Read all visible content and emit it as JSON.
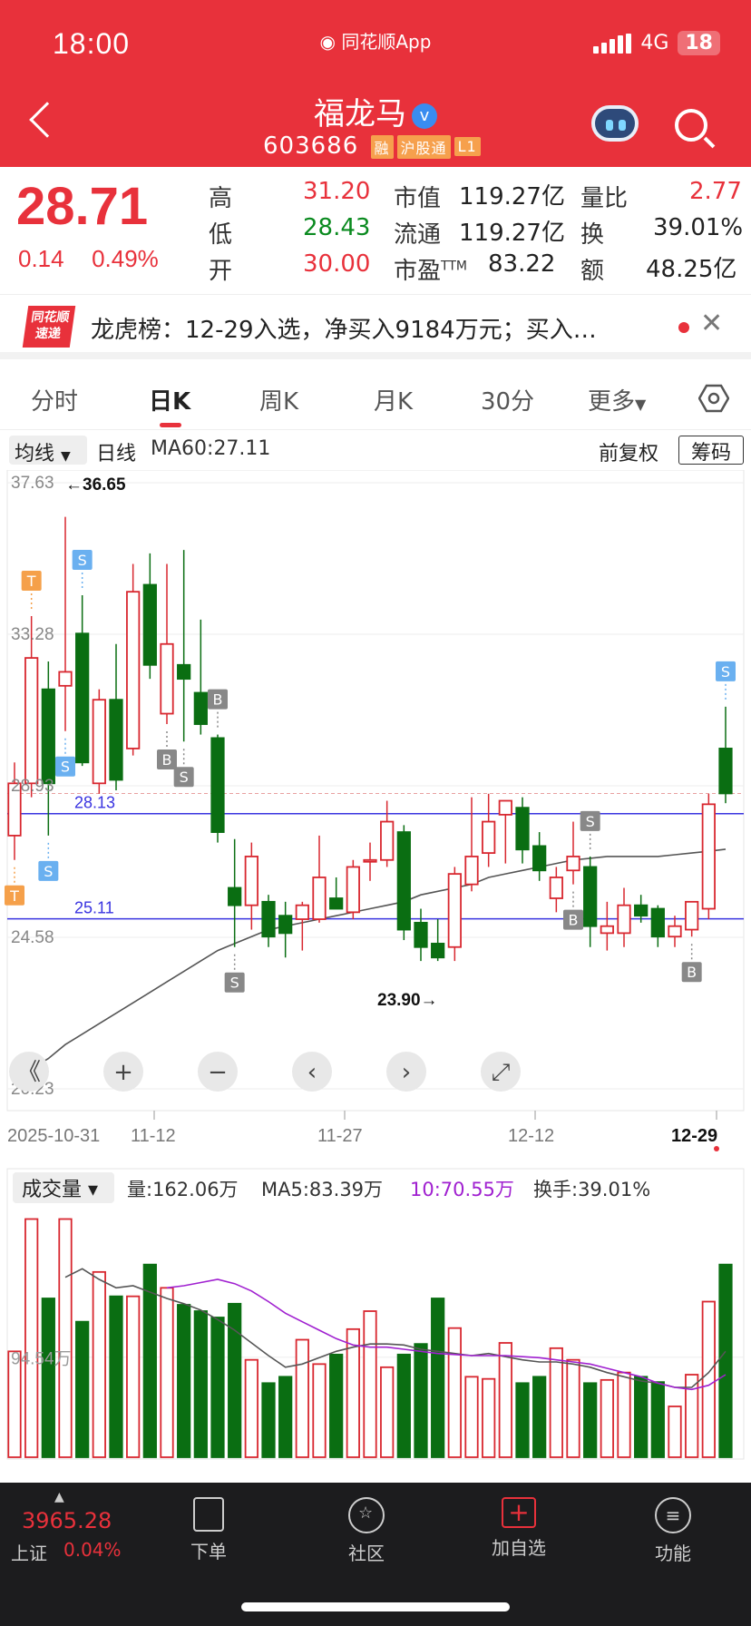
{
  "status_bar": {
    "time": "18:00",
    "app": "同花顺App",
    "network": "4G",
    "battery": "18"
  },
  "stock": {
    "name": "福龙马",
    "code": "603686",
    "tags": [
      "融",
      "沪股通",
      "L1"
    ]
  },
  "quote": {
    "price": "28.71",
    "change": "0.14",
    "change_pct": "0.49%",
    "high_label": "高",
    "high": "31.20",
    "low_label": "低",
    "low": "28.43",
    "open_label": "开",
    "open": "30.00",
    "mcap_label": "市值",
    "mcap": "119.27亿",
    "float_label": "流通",
    "float": "119.27亿",
    "pe_label": "市盈",
    "pe_sup": "TTM",
    "pe": "83.22",
    "vr_label": "量比",
    "vr": "2.77",
    "turnover_label": "换",
    "turnover": "39.01%",
    "amount_label": "额",
    "amount": "48.25亿"
  },
  "news": {
    "logo_top": "同花顺",
    "logo_bottom": "速递",
    "text": "龙虎榜：12-29入选，净买入9184万元；买入…"
  },
  "tabs": [
    "分时",
    "日K",
    "周K",
    "月K",
    "30分",
    "更多"
  ],
  "ma_bar": {
    "dropdown": "均线",
    "period": "日线",
    "ma60": "MA60:27.11",
    "adjust": "前复权",
    "chips": "筹码"
  },
  "chart_data": [
    {
      "type": "candlestick",
      "price_axis_ticks": [
        "37.63",
        "33.28",
        "28.93",
        "24.58",
        "20.23"
      ],
      "ylim": [
        20.23,
        37.63
      ],
      "date_ticks": [
        "2025-10-31",
        "11-12",
        "11-27",
        "12-12",
        "12-29"
      ],
      "annotations": {
        "high": "←36.65",
        "low": "23.90→",
        "line1": "28.13",
        "line2": "25.11"
      },
      "ma60": "MA60:27.11",
      "candles": [
        {
          "o": 27.5,
          "h": 29.6,
          "l": 26.8,
          "c": 29.0
        },
        {
          "o": 29.0,
          "h": 33.8,
          "l": 28.6,
          "c": 32.6
        },
        {
          "o": 31.7,
          "h": 32.5,
          "l": 27.5,
          "c": 29.0
        },
        {
          "o": 31.8,
          "h": 36.65,
          "l": 30.5,
          "c": 32.2
        },
        {
          "o": 33.3,
          "h": 34.4,
          "l": 29.5,
          "c": 29.6
        },
        {
          "o": 29.0,
          "h": 31.7,
          "l": 28.7,
          "c": 31.4
        },
        {
          "o": 31.4,
          "h": 33.0,
          "l": 28.8,
          "c": 29.1
        },
        {
          "o": 30.0,
          "h": 35.3,
          "l": 29.8,
          "c": 34.5
        },
        {
          "o": 34.7,
          "h": 35.6,
          "l": 32.0,
          "c": 32.4
        },
        {
          "o": 31.0,
          "h": 35.3,
          "l": 30.7,
          "c": 33.0
        },
        {
          "o": 32.4,
          "h": 35.7,
          "l": 30.2,
          "c": 32.0
        },
        {
          "o": 31.6,
          "h": 33.7,
          "l": 30.4,
          "c": 30.7
        },
        {
          "o": 30.3,
          "h": 30.4,
          "l": 27.3,
          "c": 27.6
        },
        {
          "o": 26.0,
          "h": 27.4,
          "l": 24.3,
          "c": 25.5
        },
        {
          "o": 25.5,
          "h": 27.3,
          "l": 24.8,
          "c": 26.9
        },
        {
          "o": 25.6,
          "h": 25.8,
          "l": 24.3,
          "c": 24.6
        },
        {
          "o": 25.2,
          "h": 25.6,
          "l": 24.0,
          "c": 24.7
        },
        {
          "o": 25.1,
          "h": 25.6,
          "l": 24.2,
          "c": 25.5
        },
        {
          "o": 25.1,
          "h": 27.5,
          "l": 25.0,
          "c": 26.3
        },
        {
          "o": 25.7,
          "h": 26.3,
          "l": 25.4,
          "c": 25.4
        },
        {
          "o": 25.3,
          "h": 26.8,
          "l": 25.1,
          "c": 26.6
        },
        {
          "o": 26.8,
          "h": 27.3,
          "l": 26.2,
          "c": 26.8
        },
        {
          "o": 26.8,
          "h": 28.5,
          "l": 26.6,
          "c": 27.9
        },
        {
          "o": 27.6,
          "h": 27.8,
          "l": 24.5,
          "c": 24.8
        },
        {
          "o": 25.0,
          "h": 25.4,
          "l": 23.9,
          "c": 24.3
        },
        {
          "o": 24.4,
          "h": 25.1,
          "l": 23.9,
          "c": 24.0
        },
        {
          "o": 24.3,
          "h": 26.6,
          "l": 23.9,
          "c": 26.4
        },
        {
          "o": 26.1,
          "h": 28.6,
          "l": 25.9,
          "c": 26.9
        },
        {
          "o": 27.0,
          "h": 28.7,
          "l": 26.6,
          "c": 27.9
        },
        {
          "o": 28.1,
          "h": 28.5,
          "l": 26.7,
          "c": 28.5
        },
        {
          "o": 28.3,
          "h": 28.6,
          "l": 26.7,
          "c": 27.1
        },
        {
          "o": 27.2,
          "h": 27.6,
          "l": 26.2,
          "c": 26.5
        },
        {
          "o": 25.7,
          "h": 26.6,
          "l": 25.3,
          "c": 26.3
        },
        {
          "o": 26.5,
          "h": 27.9,
          "l": 26.1,
          "c": 26.9
        },
        {
          "o": 26.6,
          "h": 26.9,
          "l": 24.3,
          "c": 24.9
        },
        {
          "o": 24.7,
          "h": 25.6,
          "l": 24.2,
          "c": 24.9
        },
        {
          "o": 24.7,
          "h": 26.0,
          "l": 24.3,
          "c": 25.5
        },
        {
          "o": 25.5,
          "h": 25.8,
          "l": 25.0,
          "c": 25.2
        },
        {
          "o": 25.4,
          "h": 25.5,
          "l": 24.3,
          "c": 24.6
        },
        {
          "o": 24.6,
          "h": 25.2,
          "l": 24.3,
          "c": 24.9
        },
        {
          "o": 24.8,
          "h": 25.6,
          "l": 24.6,
          "c": 25.6
        },
        {
          "o": 25.4,
          "h": 28.7,
          "l": 25.1,
          "c": 28.4
        },
        {
          "o": 30.0,
          "h": 31.2,
          "l": 28.43,
          "c": 28.71
        }
      ],
      "ma_line": [
        20.4,
        20.8,
        21.1,
        21.5,
        21.8,
        22.1,
        22.4,
        22.7,
        23.0,
        23.3,
        23.6,
        23.9,
        24.2,
        24.4,
        24.6,
        24.8,
        24.9,
        25.0,
        25.1,
        25.2,
        25.3,
        25.4,
        25.5,
        25.6,
        25.8,
        25.9,
        26.0,
        26.1,
        26.3,
        26.4,
        26.5,
        26.6,
        26.7,
        26.8,
        26.85,
        26.9,
        26.9,
        26.9,
        26.9,
        26.95,
        27.0,
        27.05,
        27.11
      ],
      "signals": [
        {
          "label": "T",
          "index": 1,
          "pos": "above"
        },
        {
          "label": "T",
          "index": 0,
          "pos": "below"
        },
        {
          "label": "S",
          "index": 4,
          "pos": "above"
        },
        {
          "label": "S",
          "index": 3,
          "pos": "below"
        },
        {
          "label": "S",
          "index": 2,
          "pos": "below"
        },
        {
          "label": "B",
          "index": 9,
          "pos": "below"
        },
        {
          "label": "S",
          "index": 10,
          "pos": "below"
        },
        {
          "label": "B",
          "index": 12,
          "pos": "above"
        },
        {
          "label": "S",
          "index": 13,
          "pos": "below"
        },
        {
          "label": "S",
          "index": 34,
          "pos": "above"
        },
        {
          "label": "B",
          "index": 33,
          "pos": "below"
        },
        {
          "label": "B",
          "index": 40,
          "pos": "below"
        },
        {
          "label": "S",
          "index": 42,
          "pos": "above"
        }
      ]
    },
    {
      "type": "bar",
      "title": "成交量",
      "info": {
        "vol": "量:162.06万",
        "ma5": "MA5:83.39万",
        "ma10": "10:70.55万",
        "turnover": "换手:39.01%"
      },
      "axis_label": "94.54万",
      "values": [
        100,
        225,
        150,
        225,
        128,
        175,
        152,
        152,
        182,
        160,
        144,
        138,
        132,
        145,
        92,
        70,
        76,
        111,
        88,
        97,
        121,
        138,
        85,
        97,
        107,
        150,
        122,
        76,
        74,
        108,
        70,
        76,
        103,
        92,
        70,
        73,
        80,
        76,
        71,
        48,
        78,
        147,
        182
      ],
      "ma5": [
        null,
        null,
        null,
        170,
        178,
        168,
        160,
        162,
        156,
        150,
        145,
        139,
        130,
        120,
        108,
        96,
        85,
        88,
        94,
        100,
        104,
        107,
        107,
        106,
        102,
        100,
        98,
        96,
        98,
        95,
        92,
        90,
        90,
        88,
        85,
        80,
        76,
        72,
        70,
        66,
        66,
        80,
        100
      ],
      "ma10": [
        null,
        null,
        null,
        null,
        null,
        null,
        null,
        null,
        null,
        160,
        162,
        165,
        168,
        164,
        157,
        147,
        136,
        128,
        120,
        112,
        106,
        104,
        104,
        102,
        100,
        98,
        97,
        96,
        96,
        96,
        95,
        94,
        92,
        90,
        88,
        84,
        80,
        76,
        70,
        66,
        64,
        68,
        78
      ]
    }
  ],
  "bottom_nav": {
    "index_name": "上证",
    "index_value": "3965.28",
    "index_pct": "0.04%",
    "items": [
      "下单",
      "社区",
      "加自选",
      "功能"
    ]
  }
}
